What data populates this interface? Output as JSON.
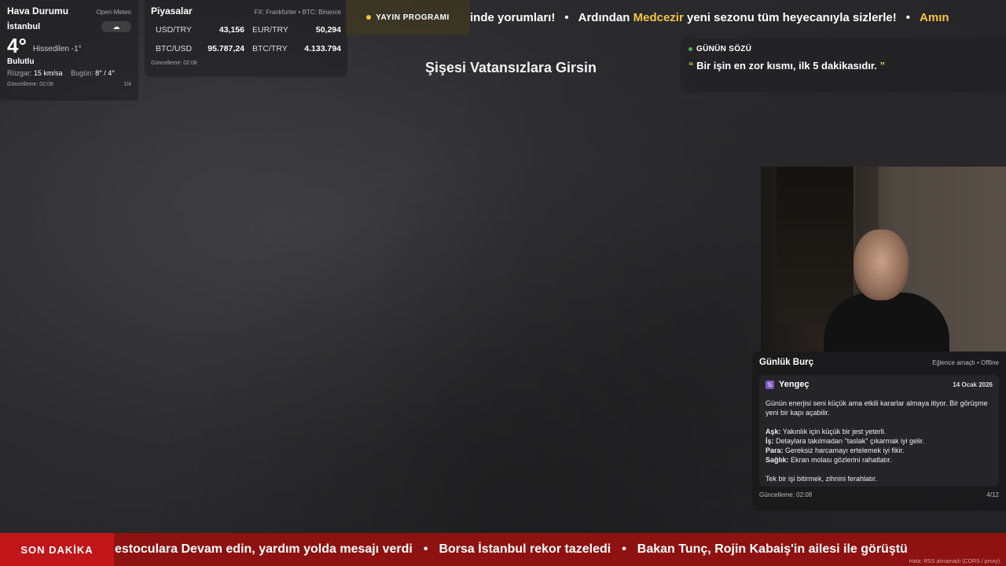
{
  "weather": {
    "title": "Hava Durumu",
    "source": "Open-Meteo",
    "city": "İstanbul",
    "cloud_icon": "☁",
    "temp": "4°",
    "feels": "Hissedilen -1°",
    "condition": "Bulutlu",
    "wind_label": "Rüzgar:",
    "wind_value": "15 km/sa",
    "today_label": "Bugün:",
    "today_value": "8° / 4°",
    "updated": "Güncelleme: 02:08",
    "page": "1/4"
  },
  "markets": {
    "title": "Piyasalar",
    "source": "FX: Frankfurter • BTC: Binance",
    "items": [
      {
        "pair": "USD/TRY",
        "value": "43,156"
      },
      {
        "pair": "EUR/TRY",
        "value": "50,294"
      },
      {
        "pair": "BTC/USD",
        "value": "95.787,24"
      },
      {
        "pair": "BTC/TRY",
        "value": "4.133.794"
      }
    ],
    "updated": "Güncelleme: 02:08"
  },
  "top_ticker": {
    "badge": "YAYIN PROGRAMI",
    "text_1": "inde yorumları!",
    "text_2a": "Ardından ",
    "text_2_highlight": "Medcezir",
    "text_2b": " yeni sezonu tüm heyecanıyla sizlerle!",
    "text_3": "Amın",
    "separator": "•"
  },
  "center_title": "Şişesi Vatansızlara Girsin",
  "quote": {
    "label": "GÜNÜN SÖZÜ",
    "open_mark": "“",
    "text": " Bir işin en zor kısmı, ilk 5 dakikasıdır. ",
    "close_mark": "”"
  },
  "horoscope": {
    "title": "Günlük Burç",
    "meta": "Eğlence amaçlı • Offline",
    "sign_icon": "♋",
    "sign": "Yengeç",
    "date": "14 Ocak 2026",
    "intro": "Günün enerjisi seni küçük ama etkili kararlar almaya itiyor. Bir görüşme yeni bir kapı açabilir.",
    "love_label": "Aşk:",
    "love": " Yakınlık için küçük bir jest yeterli.",
    "work_label": "İş:",
    "work": " Detaylara takılmadan \"taslak\" çıkarmak iyi gelir.",
    "money_label": "Para:",
    "money": " Gereksiz harcamayı ertelemek iyi fikir.",
    "health_label": "Sağlık:",
    "health": " Ekran molası gözlerini rahatlatır.",
    "closing": "Tek bir işi bitirmek, zihnini ferahlatır.",
    "updated": "Güncelleme: 02:08",
    "page": "4/12"
  },
  "breaking": {
    "label": "SON DAKİKA",
    "item_1": "estoculara Devam edin, yardım yolda mesajı verdi",
    "item_2": "Borsa İstanbul rekor tazeledi",
    "item_3": "Bakan Tunç, Rojin Kabaiş'in ailesi ile görüştü",
    "separator": "•",
    "rss_error": "Hata: RSS alınamadı (CORS / proxy)."
  }
}
